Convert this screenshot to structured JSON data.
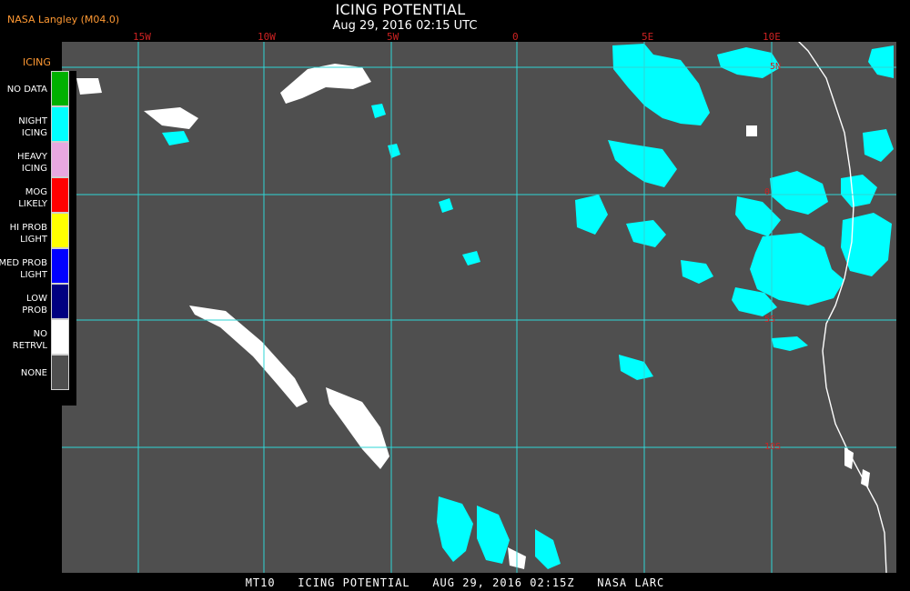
{
  "header": {
    "source": "NASA Langley (M04.0)",
    "title": "ICING POTENTIAL",
    "date": "Aug 29, 2016 02:15 UTC"
  },
  "longitude_labels": [
    "15W",
    "10W",
    "5W",
    "0",
    "5E",
    "10E"
  ],
  "latitude_labels": [
    "5N",
    "0",
    "5S",
    "10S"
  ],
  "legend": {
    "title": "ICING",
    "items": [
      {
        "label_1": "NO DATA",
        "label_2": "",
        "color": "#00b000"
      },
      {
        "label_1": "NIGHT",
        "label_2": "ICING",
        "color": "#00ffff"
      },
      {
        "label_1": "HEAVY",
        "label_2": "ICING",
        "color": "#e8a8e0"
      },
      {
        "label_1": "MOG",
        "label_2": "LIKELY",
        "color": "#ff0000"
      },
      {
        "label_1": "HI PROB",
        "label_2": "LIGHT",
        "color": "#ffff00"
      },
      {
        "label_1": "MED PROB",
        "label_2": "LIGHT",
        "color": "#0000ff"
      },
      {
        "label_1": "LOW",
        "label_2": "PROB",
        "color": "#000080"
      },
      {
        "label_1": "NO",
        "label_2": "RETRVL",
        "color": "#ffffff"
      },
      {
        "label_1": "NONE",
        "label_2": "",
        "color": "#4f4f4f"
      }
    ]
  },
  "footer": "MT10   ICING POTENTIAL   AUG 29, 2016 02:15Z   NASA LARC",
  "colors": {
    "map_background": "#4f4f4f",
    "grid": "#2fd6d6",
    "night_icing": "#00ffff",
    "no_retrieval": "#ffffff",
    "coastline": "#ffffff",
    "grid_labels": "#cc2222"
  }
}
